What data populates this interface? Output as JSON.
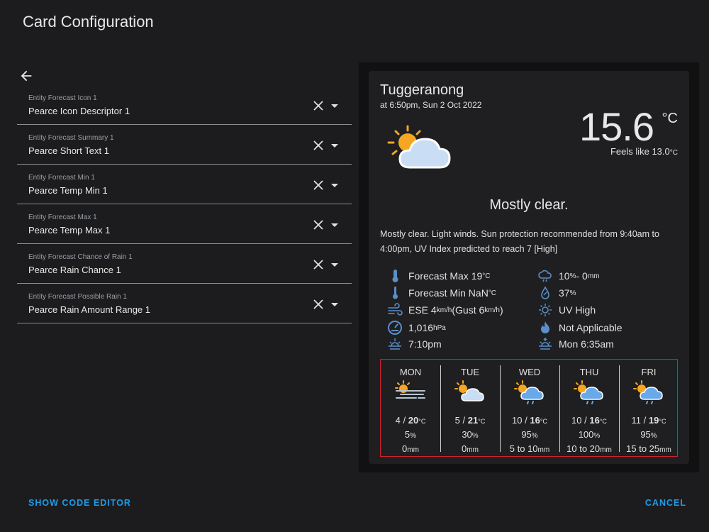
{
  "dialog": {
    "title": "Card Configuration",
    "show_code_editor": "SHOW CODE EDITOR",
    "cancel": "CANCEL"
  },
  "fields": [
    {
      "label": "Entity Forecast Icon 1",
      "value": "Pearce Icon Descriptor 1"
    },
    {
      "label": "Entity Forecast Summary 1",
      "value": "Pearce Short Text 1"
    },
    {
      "label": "Entity Forecast Min 1",
      "value": "Pearce Temp Min 1"
    },
    {
      "label": "Entity Forecast Max 1",
      "value": "Pearce Temp Max 1"
    },
    {
      "label": "Entity Forecast Chance of Rain 1",
      "value": "Pearce Rain Chance 1"
    },
    {
      "label": "Entity Forecast Possible Rain 1",
      "value": "Pearce Rain Amount Range 1"
    }
  ],
  "card": {
    "location": "Tuggeranong",
    "time": "at 6:50pm, Sun 2 Oct 2022",
    "temperature": "15.6",
    "temp_unit": "°C",
    "feels_like": "Feels like 13.0",
    "feels_unit": "°C",
    "condition": "Mostly clear.",
    "summary": "Mostly clear. Light winds. Sun protection recommended from 9:40am to 4:00pm, UV Index predicted to reach 7 [High]",
    "attributes": {
      "forecast_max": "Forecast Max 19",
      "forecast_max_unit": "°C",
      "forecast_min": "Forecast Min NaN",
      "forecast_min_unit": "°C",
      "wind_prefix": "ESE 4",
      "wind_unit": "km/h",
      "gust_text": " (Gust 6",
      "gust_unit": "km/h",
      "gust_close": ")",
      "pressure": "1,016",
      "pressure_unit": "hPa",
      "sunset": "7:10pm",
      "rain_chance": "10",
      "rain_chance_unit": "%",
      "rain_amount": " - 0",
      "rain_amount_unit": "mm",
      "humidity": "37",
      "humidity_unit": "%",
      "uv": "UV High",
      "fire_danger": "Not Applicable",
      "sunrise": "Mon 6:35am"
    },
    "forecast": [
      {
        "day": "MON",
        "min": "4",
        "max": "20",
        "unit": "°C",
        "chance": "5",
        "chance_unit": "%",
        "rain": "0",
        "rain_unit": "mm",
        "icon": "haze-sun-icon"
      },
      {
        "day": "TUE",
        "min": "5",
        "max": "21",
        "unit": "°C",
        "chance": "30",
        "chance_unit": "%",
        "rain": "0",
        "rain_unit": "mm",
        "icon": "partly-cloudy-icon"
      },
      {
        "day": "WED",
        "min": "10",
        "max": "16",
        "unit": "°C",
        "chance": "95",
        "chance_unit": "%",
        "rain": "5 to 10",
        "rain_unit": "mm",
        "icon": "sun-cloud-rain-icon"
      },
      {
        "day": "THU",
        "min": "10",
        "max": "16",
        "unit": "°C",
        "chance": "100",
        "chance_unit": "%",
        "rain": "10 to 20",
        "rain_unit": "mm",
        "icon": "sun-cloud-rain-icon"
      },
      {
        "day": "FRI",
        "min": "11",
        "max": "19",
        "unit": "°C",
        "chance": "95",
        "chance_unit": "%",
        "rain": "15 to 25",
        "rain_unit": "mm",
        "icon": "sun-cloud-rain-icon"
      }
    ]
  },
  "colors": {
    "accent": "#1e9be9",
    "highlight_border": "#d0222d",
    "sun": "#f5a623",
    "cloud": "#c9def5",
    "icon": "#5b8fc7"
  }
}
